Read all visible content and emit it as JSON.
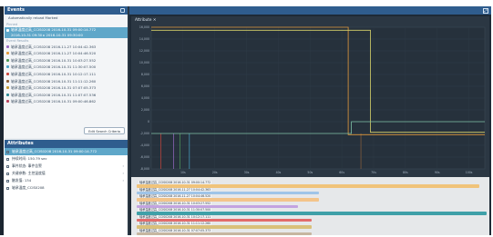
{
  "events": {
    "title": "Events",
    "option": "Automatically reload Marked",
    "group_pinned": "Pinned",
    "selected": {
      "line1": "轴承温度过高_CCIS0208 2016-10-31 09:00:14.772",
      "line2": "2016-10-31 09:30 ▸ 2016-10-31 09:30:00"
    },
    "group_events": "Event Results",
    "items": [
      {
        "label": "轴承温度过高_CCIS0208 2016-11-27 10:04:42.363",
        "color": "#9a6bc4"
      },
      {
        "label": "轴承温度过高_CCIS0208 2016-11-27 10:04:46.520",
        "color": "#e39a3b"
      },
      {
        "label": "轴承温度过高_CCIS0208 2016-10-31 10:03:27.552",
        "color": "#4f9a5a"
      },
      {
        "label": "轴承温度过高_CCIS0208 2016-10-31 11:30:07.500",
        "color": "#49a3c6"
      },
      {
        "label": "轴承温度过高_CCIS0208 2016-10-31 10:12:17.111",
        "color": "#c9463d"
      },
      {
        "label": "轴承温度过高_CCIS0208 2016-10-31 11:11:12.260",
        "color": "#8c5f3b"
      },
      {
        "label": "轴承温度过高_CCIS0208 2016-10-31 07:07:05.373",
        "color": "#c79a31"
      },
      {
        "label": "轴承温度过高_CCIS0208 2016-10-31 11:07:07.536",
        "color": "#2f8b96"
      },
      {
        "label": "轴承温度过高_CCIS0208 2016-10-31 09:00:46.862",
        "color": "#b9455f"
      }
    ],
    "search_button": "Edit Search Criteria"
  },
  "attributes": {
    "title": "Attributes",
    "items": [
      {
        "label": "轴承温度过高_CCIS0208 2016-10-31 09:00:14.772",
        "selected": true,
        "chev": ""
      },
      {
        "label": "持续时间: 150.79 sec",
        "selected": false,
        "chev": ""
      },
      {
        "label": "事件状态: 事件告警",
        "selected": false,
        "chev": "›"
      },
      {
        "label": "关键参数: 主控温度值",
        "selected": false,
        "chev": "›"
      },
      {
        "label": "触发值: 134",
        "selected": false,
        "chev": "›"
      },
      {
        "label": "轴承温度_CCIS0208",
        "selected": false,
        "chev": ""
      }
    ]
  },
  "chart": {
    "panel_title": "Attribute ✕",
    "bg": "#2b3743"
  },
  "chart_data": {
    "type": "line",
    "title": "Attribute",
    "ylim": [
      -8000,
      16000
    ],
    "yticks": [
      "16,000",
      "14,000",
      "12,000",
      "10,000",
      "8,000",
      "6,000",
      "4,000",
      "2,000",
      "0",
      "-2,000",
      "-4,000",
      "-6,000",
      "-8,000"
    ],
    "xticks": [
      "10s",
      "20s",
      "30s",
      "40s",
      "50s",
      "60s",
      "70s",
      "80s",
      "90s",
      "100s"
    ],
    "xlim": [
      0,
      105
    ],
    "series": [
      {
        "color": "#e39a3b",
        "points": [
          [
            0,
            16000
          ],
          [
            62,
            16000
          ],
          [
            62,
            -2200
          ],
          [
            105,
            -2200
          ]
        ]
      },
      {
        "color": "#d9d36a",
        "points": [
          [
            0,
            15500
          ],
          [
            69,
            15500
          ],
          [
            69,
            -1800
          ],
          [
            105,
            -1800
          ]
        ]
      },
      {
        "color": "#7fc3a8",
        "points": [
          [
            0,
            -2000
          ],
          [
            63,
            -2000
          ],
          [
            63,
            0
          ],
          [
            105,
            0
          ]
        ]
      }
    ],
    "spikes": [
      {
        "x": 3,
        "color": "#c9463d"
      },
      {
        "x": 7,
        "color": "#9a6bc4"
      },
      {
        "x": 9,
        "color": "#4f9a5a"
      },
      {
        "x": 12,
        "color": "#49a3c6"
      },
      {
        "x": 66,
        "color": "#8c5f3b"
      }
    ]
  },
  "timeline": {
    "rows": [
      {
        "label": "轴承温度过高_CCIS0208 2016-10-31 09:00:14.772",
        "color": "#f0c37a",
        "start": 0.0,
        "end": 0.98
      },
      {
        "label": "轴承温度过高_CCIS0208 2016-11-27 10:04:42.363",
        "color": "#9fc4e8",
        "start": 0.0,
        "end": 0.52
      },
      {
        "label": "轴承温度过高_CCIS0208 2016-11-27 10:04:46.520",
        "color": "#f3c48a",
        "start": 0.0,
        "end": 0.52
      },
      {
        "label": "轴承温度过高_CCIS0208 2016-10-31 10:03:27.552",
        "color": "#c3a3e0",
        "start": 0.0,
        "end": 0.46
      },
      {
        "label": "轴承温度过高_CCIS0208 2016-10-31 11:30:07.500",
        "color": "#3fa0a8",
        "start": 0.0,
        "end": 1.0
      },
      {
        "label": "轴承温度过高_CCIS0208 2016-10-31 10:12:17.111",
        "color": "#e26b6b",
        "start": 0.0,
        "end": 0.5
      },
      {
        "label": "轴承温度过高_CCIS0208 2016-10-31 11:11:12.260",
        "color": "#d9c07a",
        "start": 0.0,
        "end": 0.5
      },
      {
        "label": "轴承温度过高_CCIS0208 2016-10-31 07:07:05.373",
        "color": "#c7b6a0",
        "start": 0.0,
        "end": 0.5
      }
    ]
  }
}
